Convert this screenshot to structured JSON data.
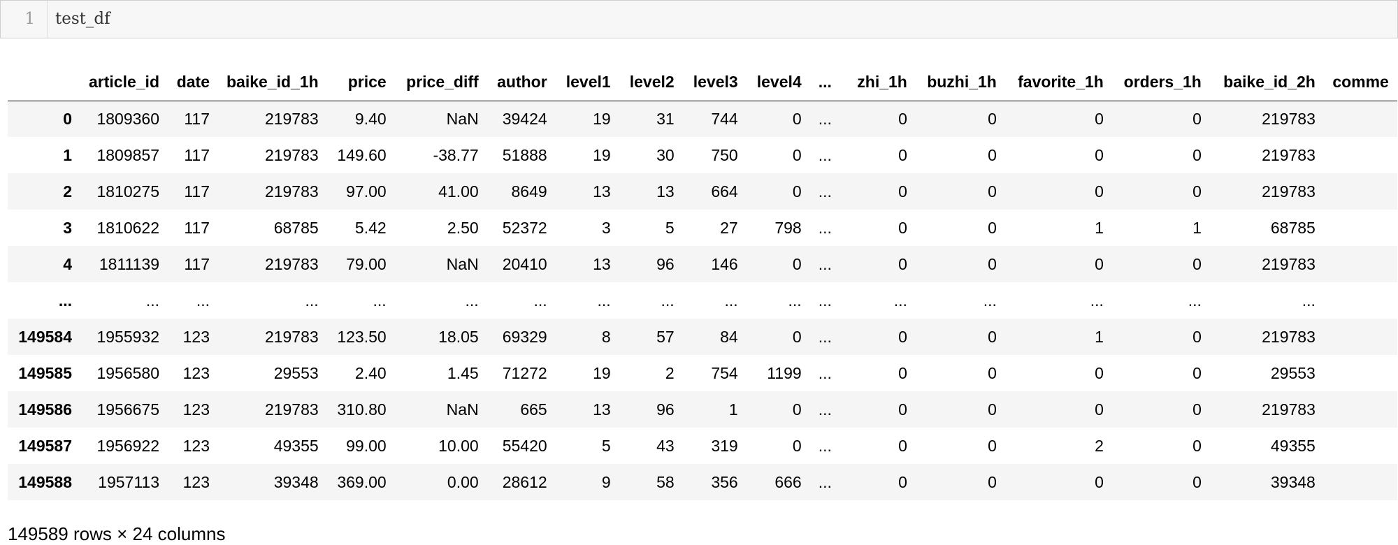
{
  "code_cell": {
    "line_number": "1",
    "code": "test_df"
  },
  "table": {
    "columns": [
      "",
      "article_id",
      "date",
      "baike_id_1h",
      "price",
      "price_diff",
      "author",
      "level1",
      "level2",
      "level3",
      "level4",
      "...",
      "zhi_1h",
      "buzhi_1h",
      "favorite_1h",
      "orders_1h",
      "baike_id_2h",
      "comme"
    ],
    "rows": [
      [
        "0",
        "1809360",
        "117",
        "219783",
        "9.40",
        "NaN",
        "39424",
        "19",
        "31",
        "744",
        "0",
        "...",
        "0",
        "0",
        "0",
        "0",
        "219783",
        ""
      ],
      [
        "1",
        "1809857",
        "117",
        "219783",
        "149.60",
        "-38.77",
        "51888",
        "19",
        "30",
        "750",
        "0",
        "...",
        "0",
        "0",
        "0",
        "0",
        "219783",
        ""
      ],
      [
        "2",
        "1810275",
        "117",
        "219783",
        "97.00",
        "41.00",
        "8649",
        "13",
        "13",
        "664",
        "0",
        "...",
        "0",
        "0",
        "0",
        "0",
        "219783",
        ""
      ],
      [
        "3",
        "1810622",
        "117",
        "68785",
        "5.42",
        "2.50",
        "52372",
        "3",
        "5",
        "27",
        "798",
        "...",
        "0",
        "0",
        "1",
        "1",
        "68785",
        ""
      ],
      [
        "4",
        "1811139",
        "117",
        "219783",
        "79.00",
        "NaN",
        "20410",
        "13",
        "96",
        "146",
        "0",
        "...",
        "0",
        "0",
        "0",
        "0",
        "219783",
        ""
      ],
      [
        "...",
        "...",
        "...",
        "...",
        "...",
        "...",
        "...",
        "...",
        "...",
        "...",
        "...",
        "...",
        "...",
        "...",
        "...",
        "...",
        "...",
        ""
      ],
      [
        "149584",
        "1955932",
        "123",
        "219783",
        "123.50",
        "18.05",
        "69329",
        "8",
        "57",
        "84",
        "0",
        "...",
        "0",
        "0",
        "1",
        "0",
        "219783",
        ""
      ],
      [
        "149585",
        "1956580",
        "123",
        "29553",
        "2.40",
        "1.45",
        "71272",
        "19",
        "2",
        "754",
        "1199",
        "...",
        "0",
        "0",
        "0",
        "0",
        "29553",
        ""
      ],
      [
        "149586",
        "1956675",
        "123",
        "219783",
        "310.80",
        "NaN",
        "665",
        "13",
        "96",
        "1",
        "0",
        "...",
        "0",
        "0",
        "0",
        "0",
        "219783",
        ""
      ],
      [
        "149587",
        "1956922",
        "123",
        "49355",
        "99.00",
        "10.00",
        "55420",
        "5",
        "43",
        "319",
        "0",
        "...",
        "0",
        "0",
        "2",
        "0",
        "49355",
        ""
      ],
      [
        "149588",
        "1957113",
        "123",
        "39348",
        "369.00",
        "0.00",
        "28612",
        "9",
        "58",
        "356",
        "666",
        "...",
        "0",
        "0",
        "0",
        "0",
        "39348",
        ""
      ]
    ]
  },
  "shape_summary": "149589 rows × 24 columns"
}
